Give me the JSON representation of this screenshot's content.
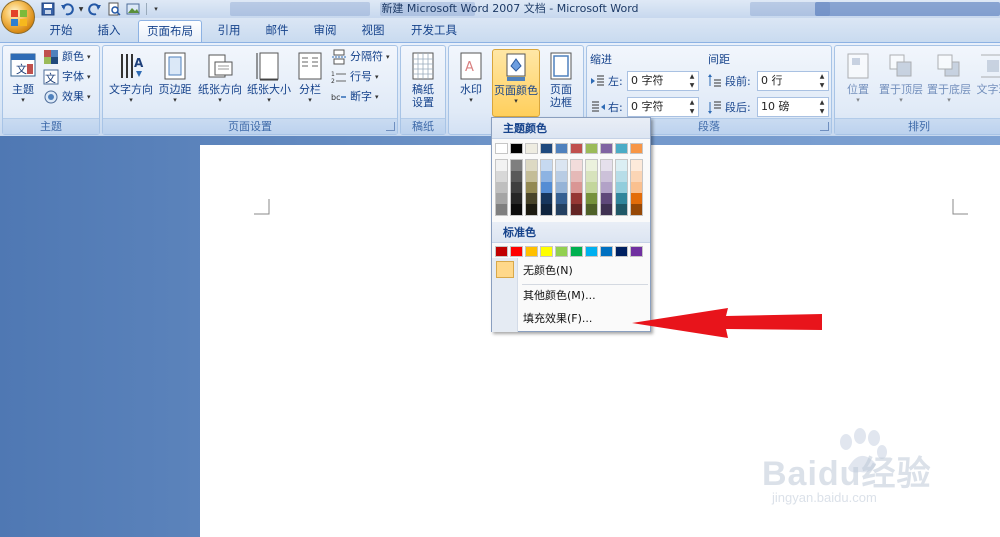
{
  "window": {
    "title": "新建 Microsoft Word 2007 文档 - Microsoft Word"
  },
  "tabs": [
    "开始",
    "插入",
    "页面布局",
    "引用",
    "邮件",
    "审阅",
    "视图",
    "开发工具"
  ],
  "active_tab": "页面布局",
  "ribbon": {
    "theme_group": {
      "label": "主题",
      "theme_button": "主题",
      "colors": "颜色",
      "fonts": "字体",
      "effects": "效果"
    },
    "page_setup_group": {
      "label": "页面设置",
      "text_direction": "文字方向",
      "margins": "页边距",
      "orientation": "纸张方向",
      "size": "纸张大小",
      "columns": "分栏",
      "breaks": "分隔符",
      "line_numbers": "行号",
      "hyphenation": "断字"
    },
    "draft_group": {
      "label": "稿纸",
      "draft_settings_line1": "稿纸",
      "draft_settings_line2": "设置"
    },
    "background_group": {
      "watermark": "水印",
      "page_color": "页面颜色",
      "page_borders_line1": "页面",
      "page_borders_line2": "边框"
    },
    "paragraph_group": {
      "label": "段落",
      "indent_title": "缩进",
      "indent_left_label": "左:",
      "indent_left_value": "0 字符",
      "indent_right_label": "右:",
      "indent_right_value": "0 字符",
      "spacing_title": "间距",
      "before_label": "段前:",
      "before_value": "0 行",
      "after_label": "段后:",
      "after_value": "10 磅"
    },
    "arrange_group": {
      "label": "排列",
      "position": "位置",
      "bring_front": "置于顶层",
      "send_back": "置于底层",
      "text_wrap": "文字环"
    }
  },
  "page_color_menu": {
    "theme_colors_header": "主题颜色",
    "theme_colors": [
      "#ffffff",
      "#000000",
      "#eeece1",
      "#1f497d",
      "#4f81bd",
      "#c0504d",
      "#9bbb59",
      "#8064a2",
      "#4bacc6",
      "#f79646"
    ],
    "theme_shades": [
      [
        "#f2f2f2",
        "#d8d8d8",
        "#bfbfbf",
        "#a5a5a5",
        "#7f7f7f"
      ],
      [
        "#7f7f7f",
        "#595959",
        "#3f3f3f",
        "#262626",
        "#0c0c0c"
      ],
      [
        "#ddd9c3",
        "#c4bd97",
        "#938953",
        "#494429",
        "#1d1b10"
      ],
      [
        "#c6d9f0",
        "#8db3e2",
        "#548dd4",
        "#17365d",
        "#0f243e"
      ],
      [
        "#dbe5f1",
        "#b8cce4",
        "#95b3d7",
        "#366092",
        "#244061"
      ],
      [
        "#f2dcdb",
        "#e5b9b7",
        "#d99694",
        "#953734",
        "#632423"
      ],
      [
        "#ebf1dd",
        "#d7e3bc",
        "#c3d69b",
        "#76923c",
        "#4f6128"
      ],
      [
        "#e5e0ec",
        "#ccc1d9",
        "#b2a2c7",
        "#5f497a",
        "#3f3151"
      ],
      [
        "#dbeef3",
        "#b7dde8",
        "#92cddc",
        "#31859b",
        "#205867"
      ],
      [
        "#fdeada",
        "#fbd5b5",
        "#fac08f",
        "#e36c09",
        "#974806"
      ]
    ],
    "standard_colors_header": "标准色",
    "standard_colors": [
      "#c00000",
      "#ff0000",
      "#ffc000",
      "#ffff00",
      "#92d050",
      "#00b050",
      "#00b0f0",
      "#0070c0",
      "#002060",
      "#7030a0"
    ],
    "no_color": "无颜色(N)",
    "more_colors": "其他颜色(M)...",
    "fill_effects": "填充效果(F)..."
  },
  "watermark": {
    "brand": "Baidu经验",
    "url": "jingyan.baidu.com"
  },
  "colors": {
    "accent_highlight": "#ffd36b",
    "annotation_arrow": "#e8141b",
    "ribbon_text": "#15428b"
  }
}
